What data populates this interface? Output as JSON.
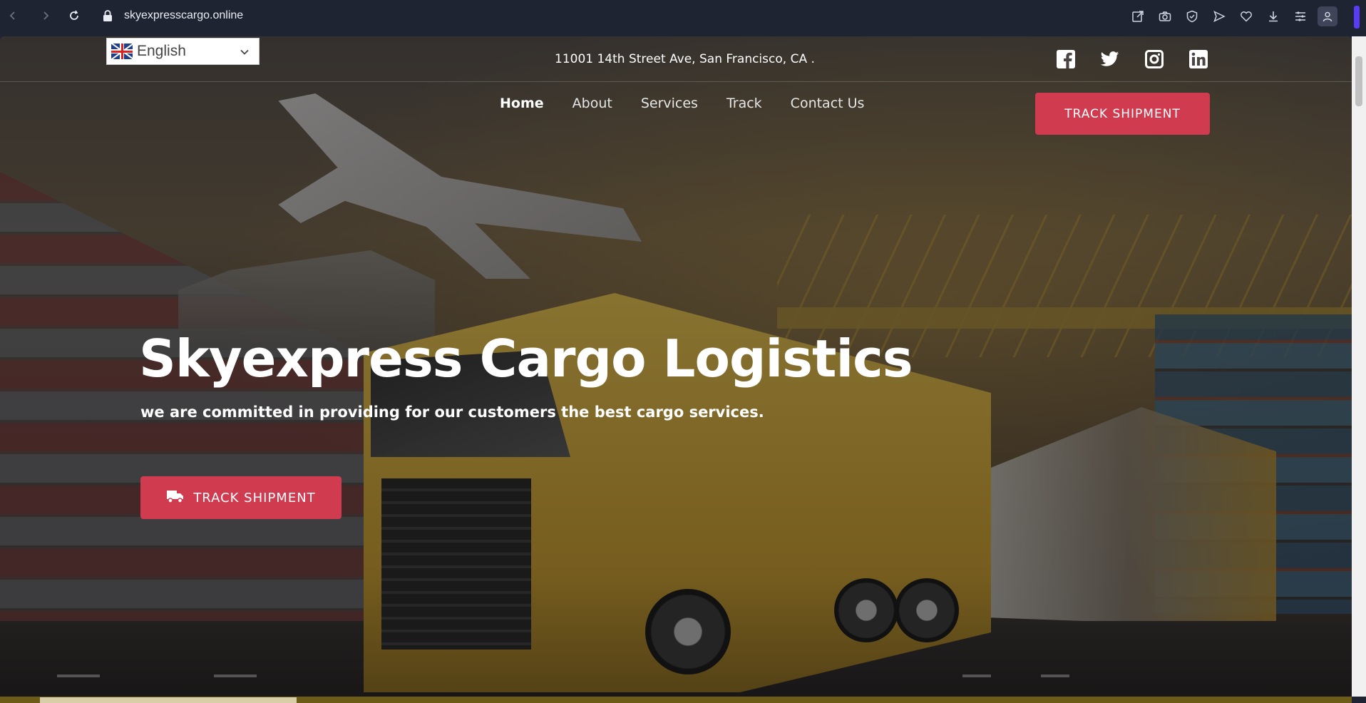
{
  "browser": {
    "url": "skyexpresscargo.online",
    "icons": [
      "back-icon",
      "forward-icon",
      "reload-icon",
      "lock-icon",
      "share-icon",
      "camera-icon",
      "shield-icon",
      "send-icon",
      "heart-icon",
      "download-icon",
      "menu-icon",
      "profile-icon"
    ]
  },
  "topbar": {
    "language": "English",
    "address": "11001 14th Street Ave, San Francisco, CA .",
    "socials": [
      "facebook-icon",
      "twitter-icon",
      "instagram-icon",
      "linkedin-icon"
    ]
  },
  "nav": {
    "links": [
      "Home",
      "About",
      "Services",
      "Track",
      "Contact Us"
    ],
    "active": "Home",
    "cta": "TRACK SHIPMENT"
  },
  "hero": {
    "title": "Skyexpress Cargo Logistics",
    "subtitle": "we are committed in providing for our customers the best cargo services.",
    "cta": "TRACK SHIPMENT"
  },
  "colors": {
    "accent": "#d03b50",
    "chrome": "#1f2433"
  }
}
